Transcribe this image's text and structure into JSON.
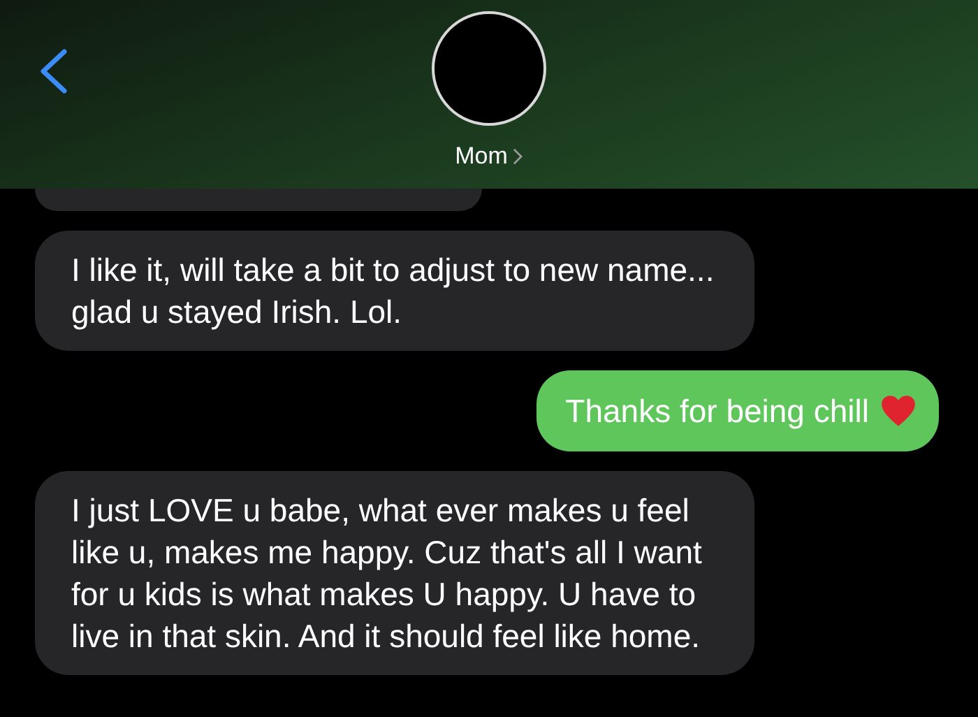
{
  "header": {
    "contact_name": "Mom"
  },
  "messages": [
    {
      "kind": "received"
    },
    {
      "kind": "received",
      "text": "I like it, will take a bit to adjust to new name... glad u stayed Irish. Lol."
    },
    {
      "kind": "sent",
      "text": "Thanks for being chill",
      "heart": true
    },
    {
      "kind": "received",
      "text": "I just LOVE u babe, what ever makes u feel like u, makes me happy. Cuz that's all I want for u kids is what makes U happy. U have to live in that skin. And it should feel like home."
    }
  ]
}
